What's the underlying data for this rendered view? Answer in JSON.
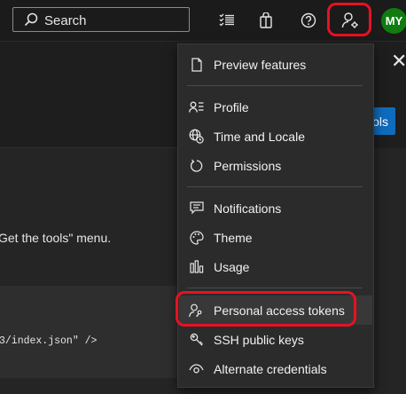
{
  "header": {
    "search_placeholder": "Search",
    "avatar_initials": "MY"
  },
  "page": {
    "instruction_fragment": "Get the tools\" menu.",
    "code_fragment": "3/index.json\" />",
    "button_fragment": "ols"
  },
  "menu": {
    "items": [
      {
        "label": "Preview features",
        "icon": "document-icon"
      },
      {
        "label": "Profile",
        "icon": "profile-icon"
      },
      {
        "label": "Time and Locale",
        "icon": "globe-clock-icon"
      },
      {
        "label": "Permissions",
        "icon": "refresh-icon"
      },
      {
        "label": "Notifications",
        "icon": "chat-icon"
      },
      {
        "label": "Theme",
        "icon": "palette-icon"
      },
      {
        "label": "Usage",
        "icon": "bar-chart-icon"
      },
      {
        "label": "Personal access tokens",
        "icon": "person-key-icon"
      },
      {
        "label": "SSH public keys",
        "icon": "key-icon"
      },
      {
        "label": "Alternate credentials",
        "icon": "eye-icon"
      }
    ]
  },
  "colors": {
    "highlight": "#e81123",
    "avatar_bg": "#107c10",
    "primary_button": "#0f6cbd"
  }
}
